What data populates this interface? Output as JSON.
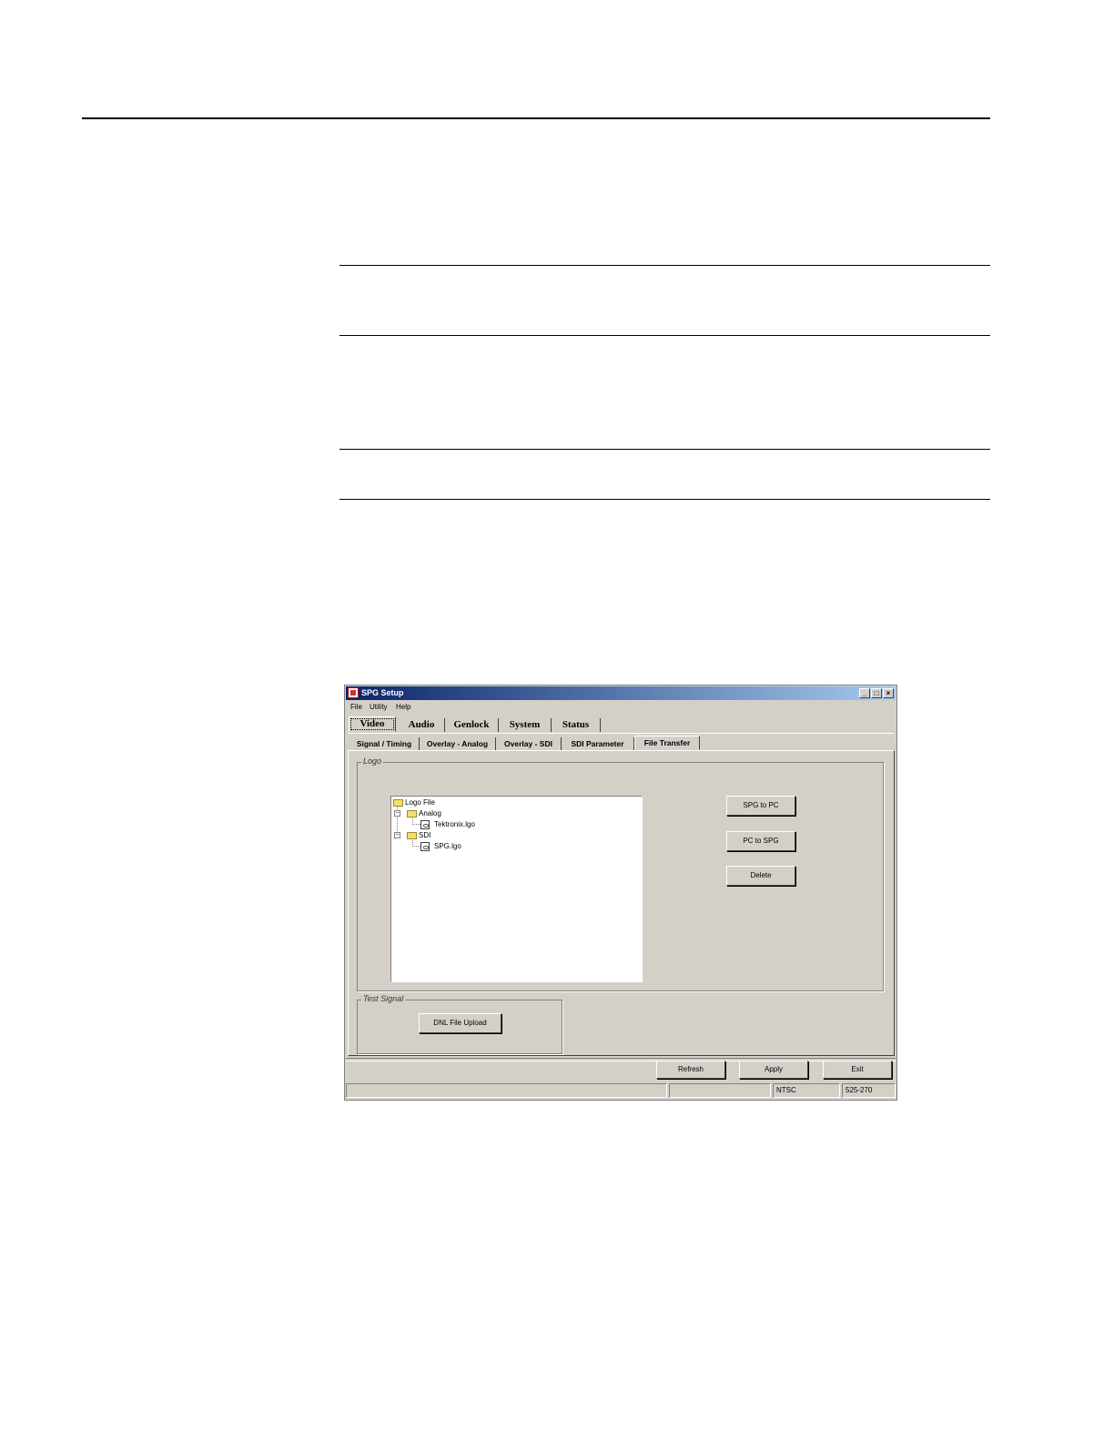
{
  "window": {
    "title": "SPG Setup",
    "menu": [
      "File",
      "Utility",
      "Help"
    ],
    "main_tabs": [
      "Video",
      "Audio",
      "Genlock",
      "System",
      "Status"
    ],
    "sub_tabs": [
      "Signal / Timing",
      "Overlay - Analog",
      "Overlay - SDI",
      "SDI Parameter",
      "File Transfer"
    ],
    "active_main_tab": "Video",
    "active_sub_tab": "File Transfer",
    "logo_group": {
      "label": "Logo",
      "tree": {
        "root": "Logo File",
        "analog_folder": "Analog",
        "analog_file": "Tektronix.lgo",
        "sdi_folder": "SDI",
        "sdi_file": "SPG.lgo"
      },
      "buttons": {
        "spg_to_pc": "SPG to PC",
        "pc_to_spg": "PC to SPG",
        "delete": "Delete"
      }
    },
    "test_signal_group": {
      "label": "Test Signal",
      "button": "DNL File Upload"
    },
    "footer_buttons": {
      "refresh": "Refresh",
      "apply": "Apply",
      "exit": "Exit"
    },
    "status": {
      "format": "NTSC",
      "model": "525-270"
    }
  }
}
